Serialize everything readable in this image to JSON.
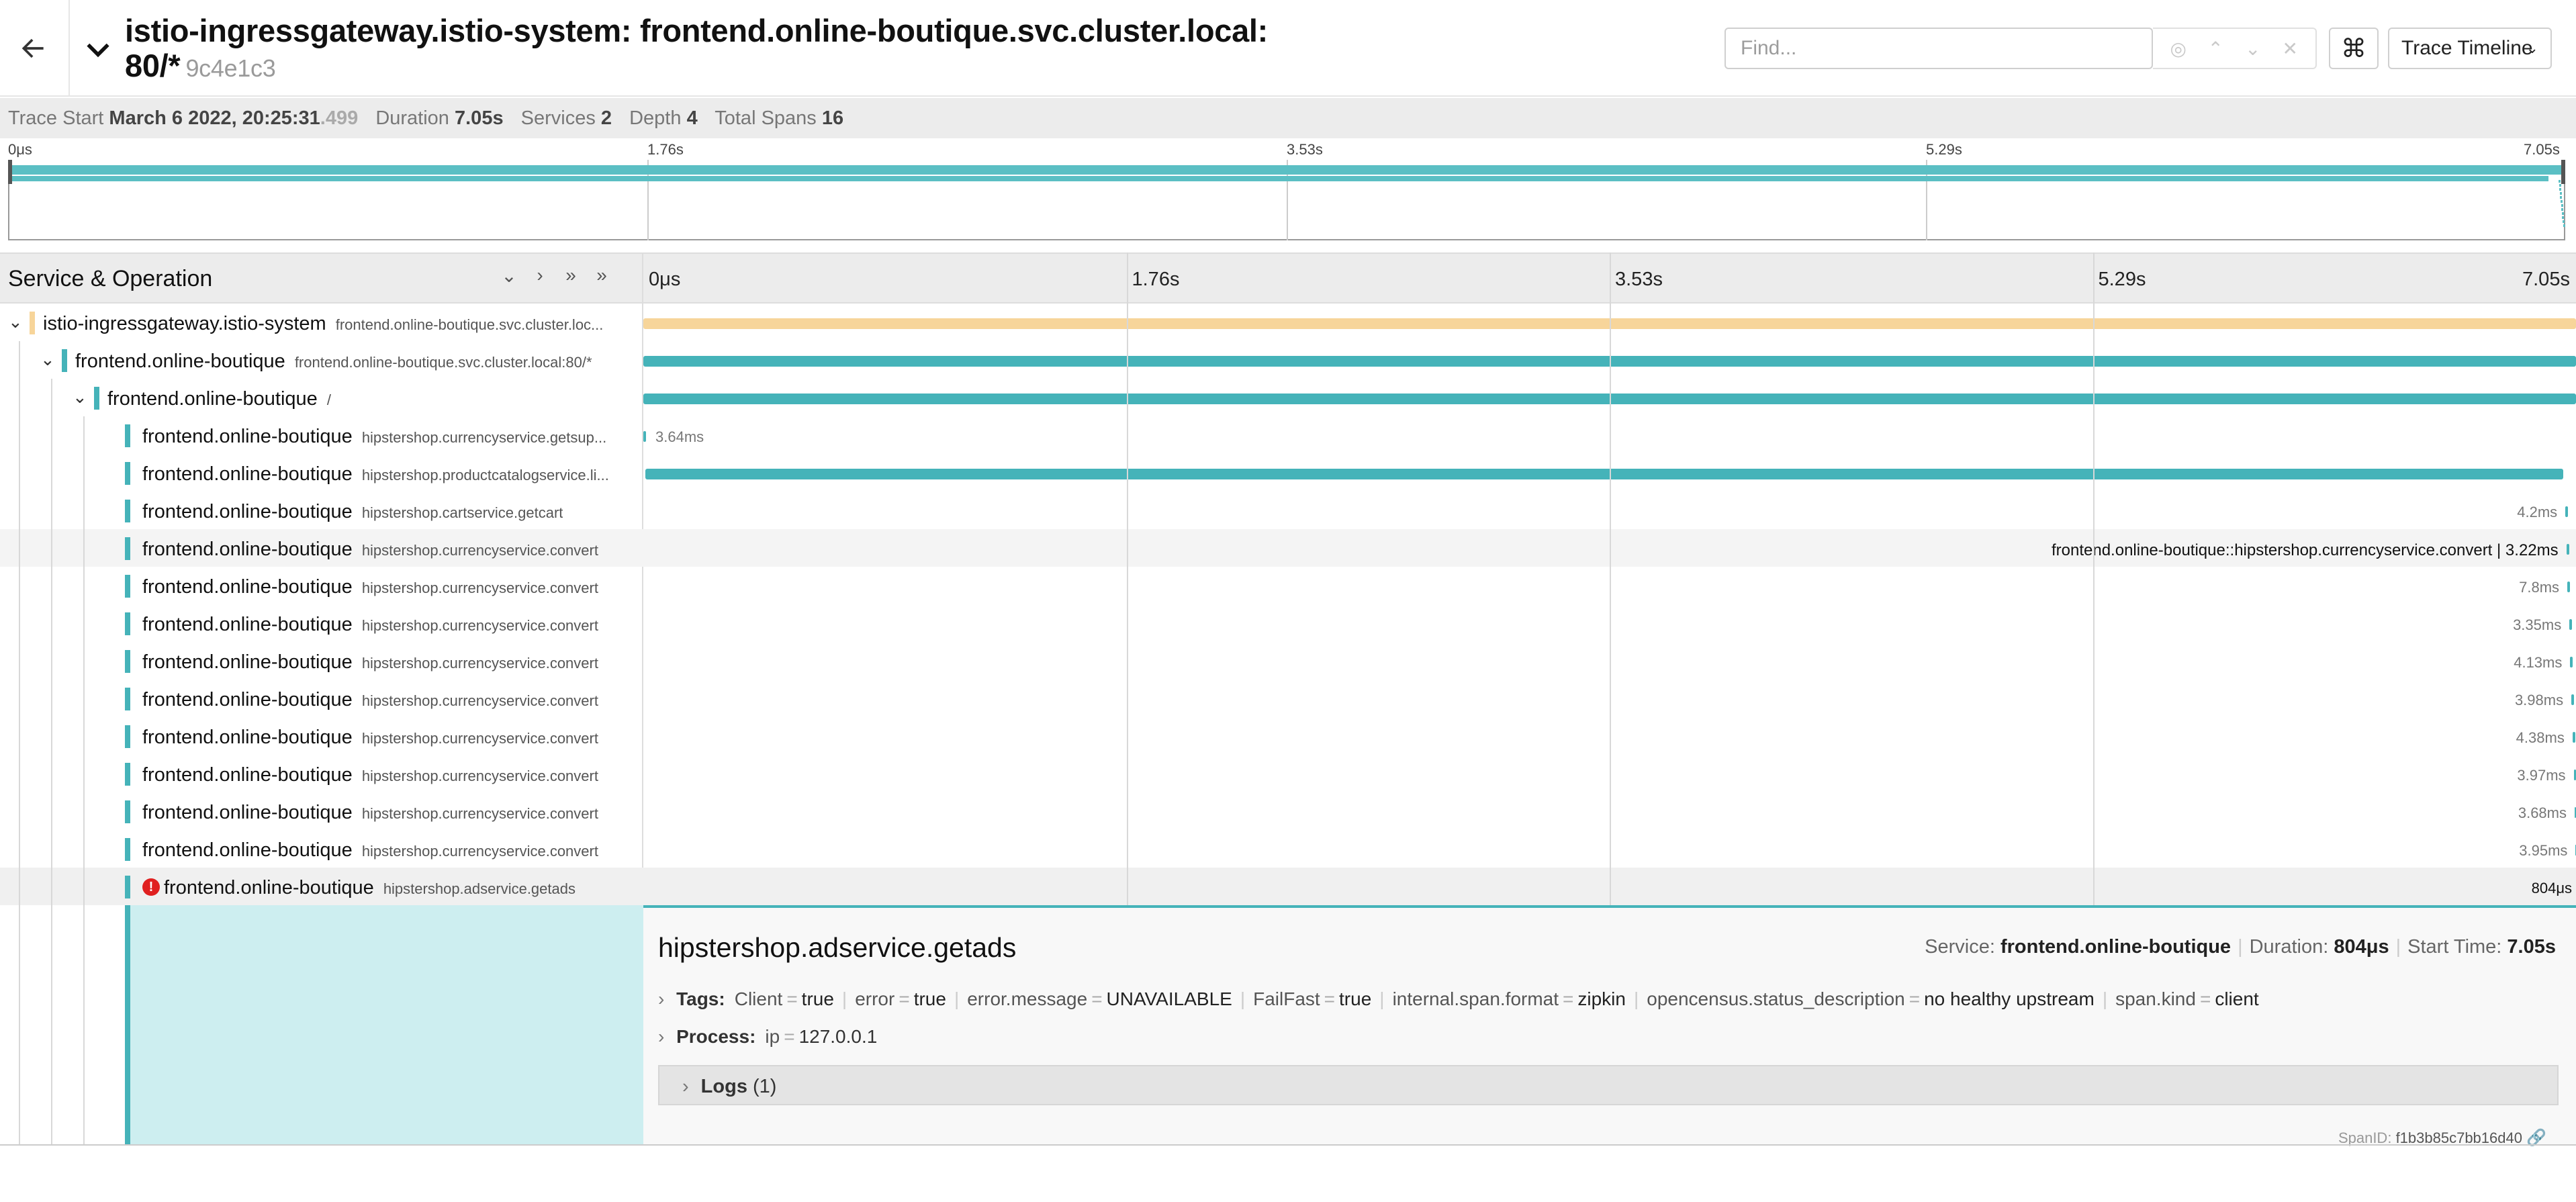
{
  "header": {
    "title": "istio-ingressgateway.istio-system: frontend.online-boutique.svc.cluster.local: 80/*",
    "trace_id": "9c4e1c3",
    "find_placeholder": "Find...",
    "view_select": "Trace Timeline",
    "kbd_icon": "⌘"
  },
  "meta": {
    "trace_start_label": "Trace Start",
    "trace_start": "March 6 2022, 20:25:31",
    "trace_start_ms": ".499",
    "duration_label": "Duration",
    "duration": "7.05s",
    "services_label": "Services",
    "services": "2",
    "depth_label": "Depth",
    "depth": "4",
    "total_spans_label": "Total Spans",
    "total_spans": "16"
  },
  "timeline_ticks": [
    "0μs",
    "1.76s",
    "3.53s",
    "5.29s",
    "7.05s"
  ],
  "panel": {
    "svc_op_label": "Service & Operation"
  },
  "spans": [
    {
      "service": "istio-ingressgateway.istio-system",
      "operation": "frontend.online-boutique.svc.cluster.loc...",
      "depth": 0,
      "color": "#f7d59a",
      "start": 0.0,
      "end": 1.0,
      "label": "",
      "toggle": "open"
    },
    {
      "service": "frontend.online-boutique",
      "operation": "frontend.online-boutique.svc.cluster.local:80/*",
      "depth": 1,
      "color": "#45b3b9",
      "start": 0.0,
      "end": 1.0,
      "label": "",
      "toggle": "open"
    },
    {
      "service": "frontend.online-boutique",
      "operation": "/",
      "depth": 2,
      "color": "#45b3b9",
      "start": 0.0,
      "end": 1.0,
      "label": "",
      "toggle": "open"
    },
    {
      "service": "frontend.online-boutique",
      "operation": "hipstershop.currencyservice.getsup...",
      "depth": 3,
      "color": "#45b3b9",
      "start": 0.0,
      "end": 0.0005,
      "label": "3.64ms",
      "toggle": ""
    },
    {
      "service": "frontend.online-boutique",
      "operation": "hipstershop.productcatalogservice.li...",
      "depth": 3,
      "color": "#45b3b9",
      "start": 0.001,
      "end": 0.9935,
      "label": "",
      "toggle": ""
    },
    {
      "service": "frontend.online-boutique",
      "operation": "hipstershop.cartservice.getcart",
      "depth": 3,
      "color": "#45b3b9",
      "start": 0.9945,
      "end": 0.995,
      "label": "4.2ms",
      "toggle": ""
    },
    {
      "service": "frontend.online-boutique",
      "operation": "hipstershop.currencyservice.convert",
      "depth": 3,
      "color": "#45b3b9",
      "start": 0.995,
      "end": 0.9955,
      "label": "frontend.online-boutique::hipstershop.currencyservice.convert | 3.22ms",
      "toggle": "",
      "hover": true
    },
    {
      "service": "frontend.online-boutique",
      "operation": "hipstershop.currencyservice.convert",
      "depth": 3,
      "color": "#45b3b9",
      "start": 0.9955,
      "end": 0.9966,
      "label": "7.8ms",
      "toggle": ""
    },
    {
      "service": "frontend.online-boutique",
      "operation": "hipstershop.currencyservice.convert",
      "depth": 3,
      "color": "#45b3b9",
      "start": 0.9966,
      "end": 0.997,
      "label": "3.35ms",
      "toggle": ""
    },
    {
      "service": "frontend.online-boutique",
      "operation": "hipstershop.currencyservice.convert",
      "depth": 3,
      "color": "#45b3b9",
      "start": 0.997,
      "end": 0.9976,
      "label": "4.13ms",
      "toggle": ""
    },
    {
      "service": "frontend.online-boutique",
      "operation": "hipstershop.currencyservice.convert",
      "depth": 3,
      "color": "#45b3b9",
      "start": 0.9976,
      "end": 0.9982,
      "label": "3.98ms",
      "toggle": ""
    },
    {
      "service": "frontend.online-boutique",
      "operation": "hipstershop.currencyservice.convert",
      "depth": 3,
      "color": "#45b3b9",
      "start": 0.9982,
      "end": 0.9988,
      "label": "4.38ms",
      "toggle": ""
    },
    {
      "service": "frontend.online-boutique",
      "operation": "hipstershop.currencyservice.convert",
      "depth": 3,
      "color": "#45b3b9",
      "start": 0.9988,
      "end": 0.9993,
      "label": "3.97ms",
      "toggle": ""
    },
    {
      "service": "frontend.online-boutique",
      "operation": "hipstershop.currencyservice.convert",
      "depth": 3,
      "color": "#45b3b9",
      "start": 0.9993,
      "end": 0.9998,
      "label": "3.68ms",
      "toggle": ""
    },
    {
      "service": "frontend.online-boutique",
      "operation": "hipstershop.currencyservice.convert",
      "depth": 3,
      "color": "#45b3b9",
      "start": 0.9998,
      "end": 1.0,
      "label": "3.95ms",
      "toggle": ""
    },
    {
      "service": "frontend.online-boutique",
      "operation": "hipstershop.adservice.getads",
      "depth": 3,
      "color": "#45b3b9",
      "start": 0.9999,
      "end": 1.0,
      "label": "804μs",
      "toggle": "",
      "error": true,
      "selected": true
    }
  ],
  "detail": {
    "title": "hipstershop.adservice.getads",
    "service_label": "Service:",
    "service": "frontend.online-boutique",
    "duration_label": "Duration:",
    "duration": "804μs",
    "start_label": "Start Time:",
    "start": "7.05s",
    "tags_label": "Tags:",
    "tags": [
      {
        "k": "Client",
        "v": "true"
      },
      {
        "k": "error",
        "v": "true"
      },
      {
        "k": "error.message",
        "v": "UNAVAILABLE"
      },
      {
        "k": "FailFast",
        "v": "true"
      },
      {
        "k": "internal.span.format",
        "v": "zipkin"
      },
      {
        "k": "opencensus.status_description",
        "v": "no healthy upstream"
      },
      {
        "k": "span.kind",
        "v": "client"
      }
    ],
    "process_label": "Process:",
    "process": [
      {
        "k": "ip",
        "v": "127.0.0.1"
      }
    ],
    "logs_label": "Logs",
    "logs_count": "(1)",
    "span_id_label": "SpanID:",
    "span_id": "f1b3b85c7bb16d40"
  },
  "colors": {
    "accent": "#45b3b9",
    "root_service": "#f7d59a",
    "error": "#e02020",
    "selected_bg": "#cdeef0"
  }
}
